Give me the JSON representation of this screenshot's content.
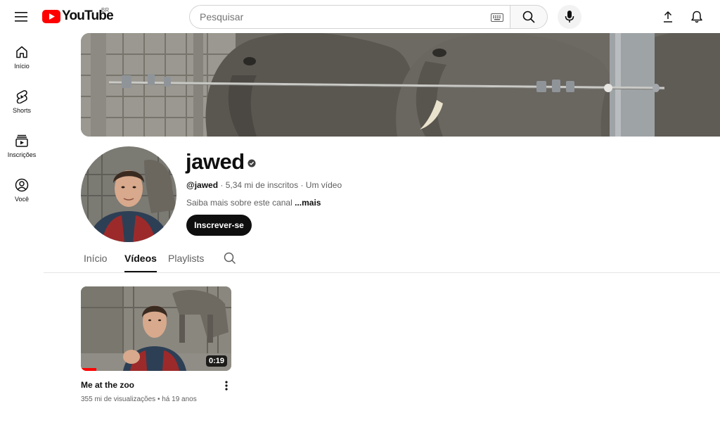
{
  "header": {
    "logo_text": "YouTube",
    "region": "BR",
    "search_placeholder": "Pesquisar"
  },
  "sidebar": {
    "items": [
      {
        "label": "Início",
        "icon": "home-icon"
      },
      {
        "label": "Shorts",
        "icon": "shorts-icon"
      },
      {
        "label": "Inscrições",
        "icon": "subscriptions-icon"
      },
      {
        "label": "Você",
        "icon": "you-icon"
      }
    ]
  },
  "channel": {
    "name": "jawed",
    "handle": "@jawed",
    "subscribers": "5,34 mi de inscritos",
    "video_count": "Um vídeo",
    "separator": " · ",
    "about_text": "Saiba mais sobre este canal ",
    "about_more": "...mais",
    "subscribe_label": "Inscrever-se"
  },
  "tabs": [
    {
      "label": "Início",
      "active": false
    },
    {
      "label": "Vídeos",
      "active": true
    },
    {
      "label": "Playlists",
      "active": false
    }
  ],
  "videos": [
    {
      "title": "Me at the zoo",
      "duration": "0:19",
      "views": "355 mi de visualizações",
      "age": "há 19 anos"
    }
  ],
  "colors": {
    "brand_red": "#ff0000",
    "text_primary": "#0f0f0f",
    "text_secondary": "#606060",
    "subscribe_bg": "#0f0f0f"
  }
}
